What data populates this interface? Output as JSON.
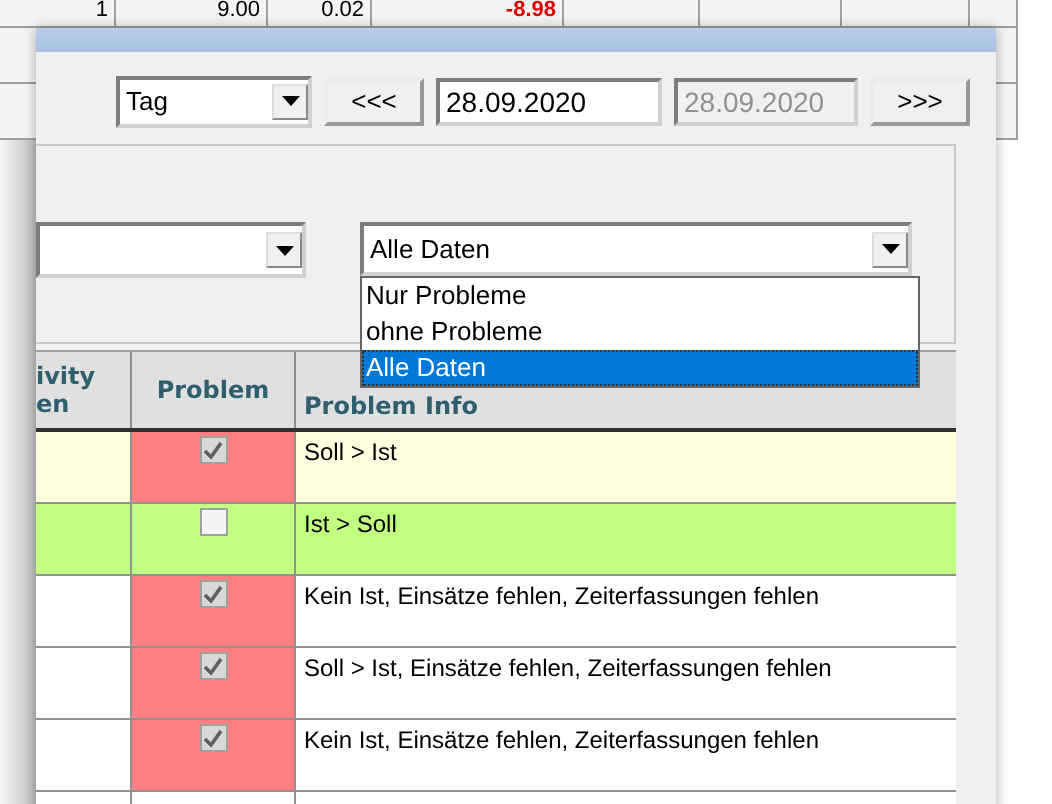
{
  "background_table": {
    "cells": [
      "1",
      "9.00",
      "0.02",
      "-8.98"
    ]
  },
  "toolbar": {
    "period_select": {
      "value": "Tag"
    },
    "prev_button": "<<<",
    "date_from": {
      "value": "28.09.2020",
      "disabled": false
    },
    "date_to": {
      "value": "28.09.2020",
      "disabled": true
    },
    "next_button": ">>>"
  },
  "filter": {
    "data_filter": {
      "value": "Alle Daten",
      "expanded": true,
      "options": [
        {
          "label": "Nur Probleme",
          "selected": false
        },
        {
          "label": "ohne Probleme",
          "selected": false
        },
        {
          "label": "Alle Daten",
          "selected": true
        }
      ]
    }
  },
  "grid": {
    "columns": [
      "ivity\nen",
      "Problem",
      "Problem Info"
    ],
    "rows": [
      {
        "color": "#ffffe0",
        "problem": true,
        "info": "Soll > Ist"
      },
      {
        "color": "#c0ff80",
        "problem": false,
        "info": "Ist > Soll"
      },
      {
        "color": "#ffffff",
        "problem": true,
        "info": "Kein Ist, Einsätze fehlen, Zeiterfassungen fehlen"
      },
      {
        "color": "#ffffff",
        "problem": true,
        "info": "Soll > Ist, Einsätze fehlen, Zeiterfassungen fehlen"
      },
      {
        "color": "#ffffff",
        "problem": true,
        "info": "Kein Ist, Einsätze fehlen, Zeiterfassungen fehlen"
      }
    ]
  }
}
